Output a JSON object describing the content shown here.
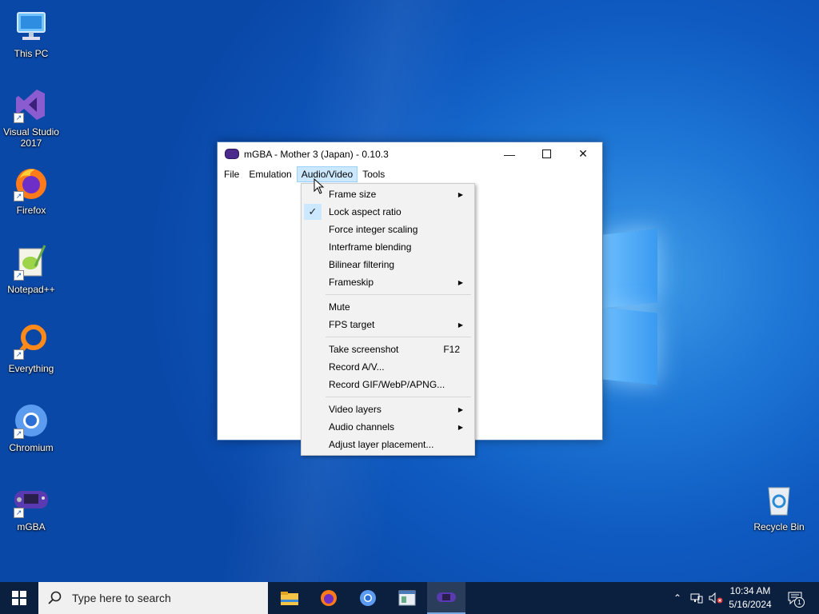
{
  "desktop": {
    "icons": [
      {
        "label": "This PC",
        "name": "this-pc-icon"
      },
      {
        "label": "Visual Studio 2017",
        "name": "visual-studio-icon"
      },
      {
        "label": "Firefox",
        "name": "firefox-icon"
      },
      {
        "label": "Notepad++",
        "name": "notepadpp-icon"
      },
      {
        "label": "Everything",
        "name": "everything-icon"
      },
      {
        "label": "Chromium",
        "name": "chromium-icon"
      },
      {
        "label": "mGBA",
        "name": "mgba-icon"
      },
      {
        "label": "Recycle Bin",
        "name": "recycle-bin-icon"
      }
    ]
  },
  "window": {
    "title": "mGBA - Mother 3 (Japan) - 0.10.3",
    "menus": [
      "File",
      "Emulation",
      "Audio/Video",
      "Tools"
    ],
    "active_menu": "Audio/Video"
  },
  "dropdown": {
    "items": [
      {
        "label": "Frame size",
        "submenu": true
      },
      {
        "label": "Lock aspect ratio",
        "checked": true
      },
      {
        "label": "Force integer scaling"
      },
      {
        "label": "Interframe blending"
      },
      {
        "label": "Bilinear filtering"
      },
      {
        "label": "Frameskip",
        "submenu": true
      },
      {
        "label": "Mute"
      },
      {
        "label": "FPS target",
        "submenu": true
      },
      {
        "label": "Take screenshot",
        "shortcut": "F12"
      },
      {
        "label": "Record A/V..."
      },
      {
        "label": "Record GIF/WebP/APNG..."
      },
      {
        "label": "Video layers",
        "submenu": true
      },
      {
        "label": "Audio channels",
        "submenu": true
      },
      {
        "label": "Adjust layer placement..."
      }
    ]
  },
  "taskbar": {
    "search_placeholder": "Type here to search",
    "time": "10:34 AM",
    "date": "5/16/2024",
    "notification_count": "1"
  },
  "colors": {
    "menu_highlight": "#cce8ff",
    "taskbar": "#0b1f3f",
    "desktop_blue": "#0f5bc2"
  }
}
